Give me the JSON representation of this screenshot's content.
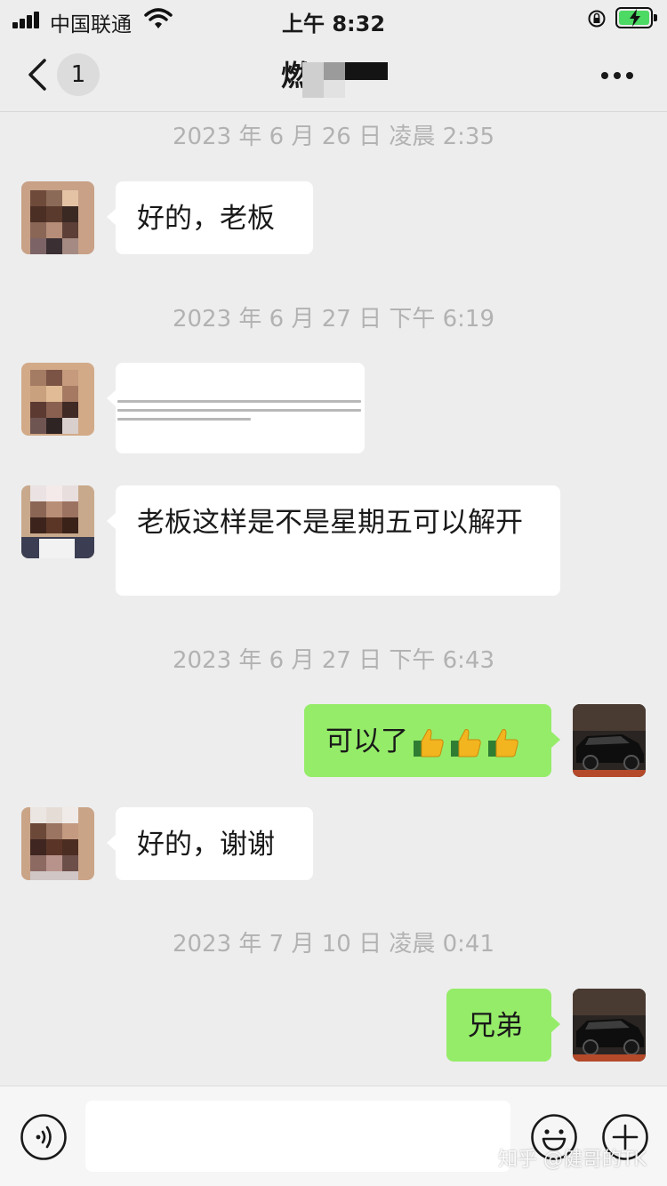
{
  "status_bar": {
    "carrier": "中国联通",
    "time": "上午 8:32"
  },
  "nav": {
    "back_icon": "chevron-left-icon",
    "unread_count": "1",
    "title_visible": "燃",
    "more_icon": "ellipsis-icon"
  },
  "messages": {
    "ts1": "2023 年 6 月 26 日 凌晨 2:35",
    "m1": "好的，老板",
    "ts2": "2023 年 6 月 27 日 下午 6:19",
    "m3": "老板这样是不是星期五可以解开",
    "ts3": "2023 年 6 月 27 日 下午 6:43",
    "m4": "可以了",
    "m5": "好的，谢谢",
    "ts4": "2023 年 7 月 10 日 凌晨 0:41",
    "m6": "兄弟"
  },
  "input_bar": {
    "voice_icon": "voice-icon",
    "emoji_icon": "emoji-icon",
    "plus_icon": "plus-icon",
    "input_value": ""
  },
  "watermark": "知乎 @健哥的TK",
  "colors": {
    "background": "#ededed",
    "incoming_bubble": "#ffffff",
    "outgoing_bubble": "#95ec69",
    "timestamp": "#b2b2b2"
  }
}
